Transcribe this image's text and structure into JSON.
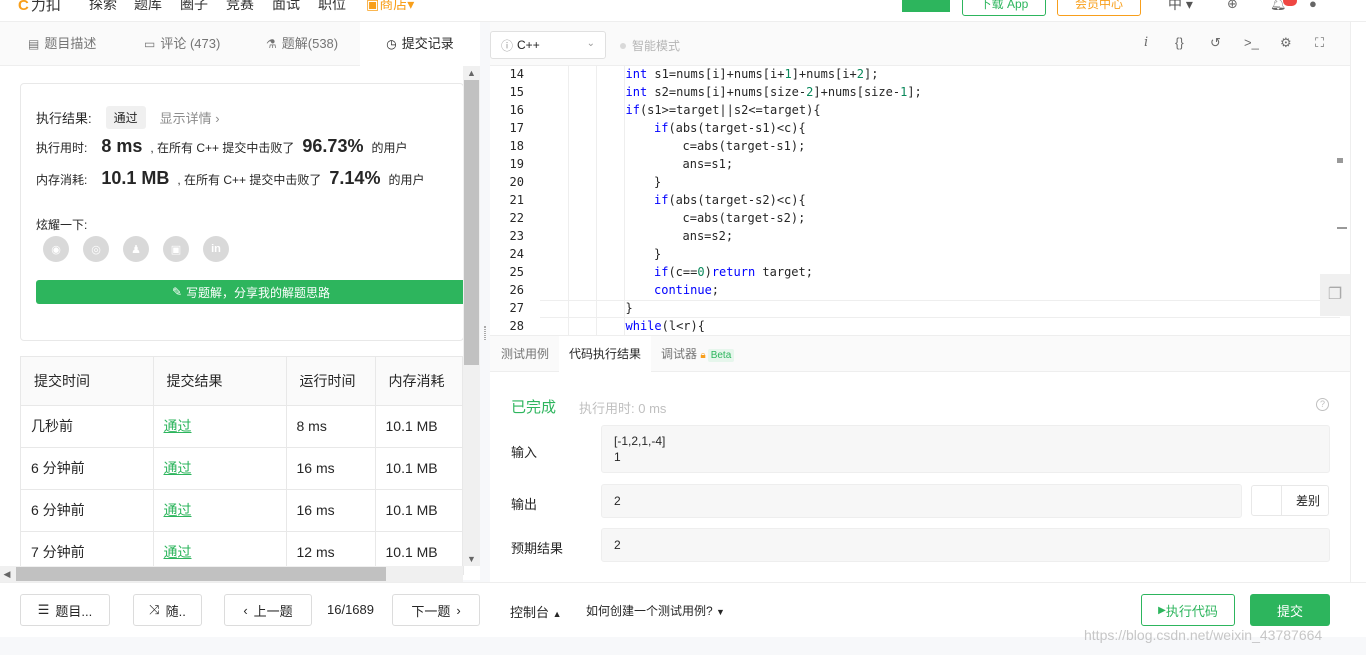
{
  "topnav": {
    "logo": "力扣",
    "items": [
      "探索",
      "题库",
      "圈子",
      "竞赛",
      "面试",
      "职位",
      "商店"
    ],
    "download_app": "下载 App",
    "vip": "会员中心",
    "lang": "中"
  },
  "left_tabs": [
    {
      "label": "题目描述",
      "icon": "document-icon"
    },
    {
      "label": "评论 (473)",
      "icon": "comment-icon"
    },
    {
      "label": "题解(538)",
      "icon": "flask-icon"
    },
    {
      "label": "提交记录",
      "icon": "clock-icon"
    }
  ],
  "result": {
    "label": "执行结果:",
    "status": "通过",
    "detail_link": "显示详情",
    "time_label": "执行用时:",
    "time_value": "8 ms",
    "time_text": ", 在所有 C++ 提交中击败了",
    "time_pct": "96.73%",
    "users": "的用户",
    "mem_label": "内存消耗:",
    "mem_value": "10.1 MB",
    "mem_text": ", 在所有 C++ 提交中击败了",
    "mem_pct": "7.14%",
    "share_label": "炫耀一下:",
    "write_btn": "写题解，分享我的解题思路"
  },
  "submissions": {
    "headers": [
      "提交时间",
      "提交结果",
      "运行时间",
      "内存消耗"
    ],
    "rows": [
      [
        "几秒前",
        "通过",
        "8 ms",
        "10.1 MB"
      ],
      [
        "6 分钟前",
        "通过",
        "16 ms",
        "10.1 MB"
      ],
      [
        "6 分钟前",
        "通过",
        "16 ms",
        "10.1 MB"
      ],
      [
        "7 分钟前",
        "通过",
        "12 ms",
        "10.1 MB"
      ]
    ]
  },
  "editor": {
    "language": "C++",
    "smart_mode": "智能模式",
    "lines": [
      {
        "n": "14",
        "indent": 3,
        "parts": [
          [
            "kw",
            "int"
          ],
          [
            "t",
            " s1=nums[i]+nums[i+"
          ],
          [
            "num",
            "1"
          ],
          [
            "t",
            "]+nums[i+"
          ],
          [
            "num",
            "2"
          ],
          [
            "t",
            "];"
          ]
        ]
      },
      {
        "n": "15",
        "indent": 3,
        "parts": [
          [
            "kw",
            "int"
          ],
          [
            "t",
            " s2=nums[i]+nums[size-"
          ],
          [
            "num",
            "2"
          ],
          [
            "t",
            "]+nums[size-"
          ],
          [
            "num",
            "1"
          ],
          [
            "t",
            "];"
          ]
        ]
      },
      {
        "n": "16",
        "indent": 3,
        "parts": [
          [
            "kw",
            "if"
          ],
          [
            "t",
            "(s1>=target||s2<=target){"
          ]
        ]
      },
      {
        "n": "17",
        "indent": 4,
        "parts": [
          [
            "kw",
            "if"
          ],
          [
            "t",
            "(abs(target-s1)<c){"
          ]
        ]
      },
      {
        "n": "18",
        "indent": 5,
        "parts": [
          [
            "t",
            "c=abs(target-s1);"
          ]
        ]
      },
      {
        "n": "19",
        "indent": 5,
        "parts": [
          [
            "t",
            "ans=s1;"
          ]
        ]
      },
      {
        "n": "20",
        "indent": 4,
        "parts": [
          [
            "t",
            "}"
          ]
        ]
      },
      {
        "n": "21",
        "indent": 4,
        "parts": [
          [
            "kw",
            "if"
          ],
          [
            "t",
            "(abs(target-s2)<c){"
          ]
        ]
      },
      {
        "n": "22",
        "indent": 5,
        "parts": [
          [
            "t",
            "c=abs(target-s2);"
          ]
        ]
      },
      {
        "n": "23",
        "indent": 5,
        "parts": [
          [
            "t",
            "ans=s2;"
          ]
        ]
      },
      {
        "n": "24",
        "indent": 4,
        "parts": [
          [
            "t",
            "}"
          ]
        ]
      },
      {
        "n": "25",
        "indent": 4,
        "parts": [
          [
            "kw",
            "if"
          ],
          [
            "t",
            "(c=="
          ],
          [
            "num",
            "0"
          ],
          [
            "t",
            ")"
          ],
          [
            "kw",
            "return"
          ],
          [
            "t",
            " target;"
          ]
        ]
      },
      {
        "n": "26",
        "indent": 4,
        "parts": [
          [
            "kw",
            "continue"
          ],
          [
            "t",
            ";"
          ]
        ]
      },
      {
        "n": "27",
        "indent": 3,
        "parts": [
          [
            "t",
            "}"
          ]
        ]
      },
      {
        "n": "28",
        "indent": 3,
        "parts": [
          [
            "kw",
            "while"
          ],
          [
            "t",
            "(l<r){"
          ]
        ]
      }
    ]
  },
  "bottom_tabs": [
    "测试用例",
    "代码执行结果",
    "调试器"
  ],
  "beta": "Beta",
  "run_result": {
    "status": "已完成",
    "elapsed": "执行用时: 0 ms",
    "input_label": "输入",
    "input_value": "[-1,2,1,-4]\n1",
    "output_label": "输出",
    "output_value": "2",
    "diff_label": "差别",
    "expected_label": "预期结果",
    "expected_value": "2"
  },
  "footer": {
    "list_btn": "题目...",
    "random_btn": "随..",
    "prev_btn": "上一题",
    "page": "16/1689",
    "next_btn": "下一题",
    "console": "控制台",
    "howto": "如何创建一个测试用例?",
    "run": "执行代码",
    "submit": "提交"
  },
  "watermark": "https://blog.csdn.net/weixin_43787664",
  "colors": {
    "accent": "#2db55d",
    "orange": "#f89f1b",
    "keyword": "#0000ff",
    "number": "#09885a"
  }
}
